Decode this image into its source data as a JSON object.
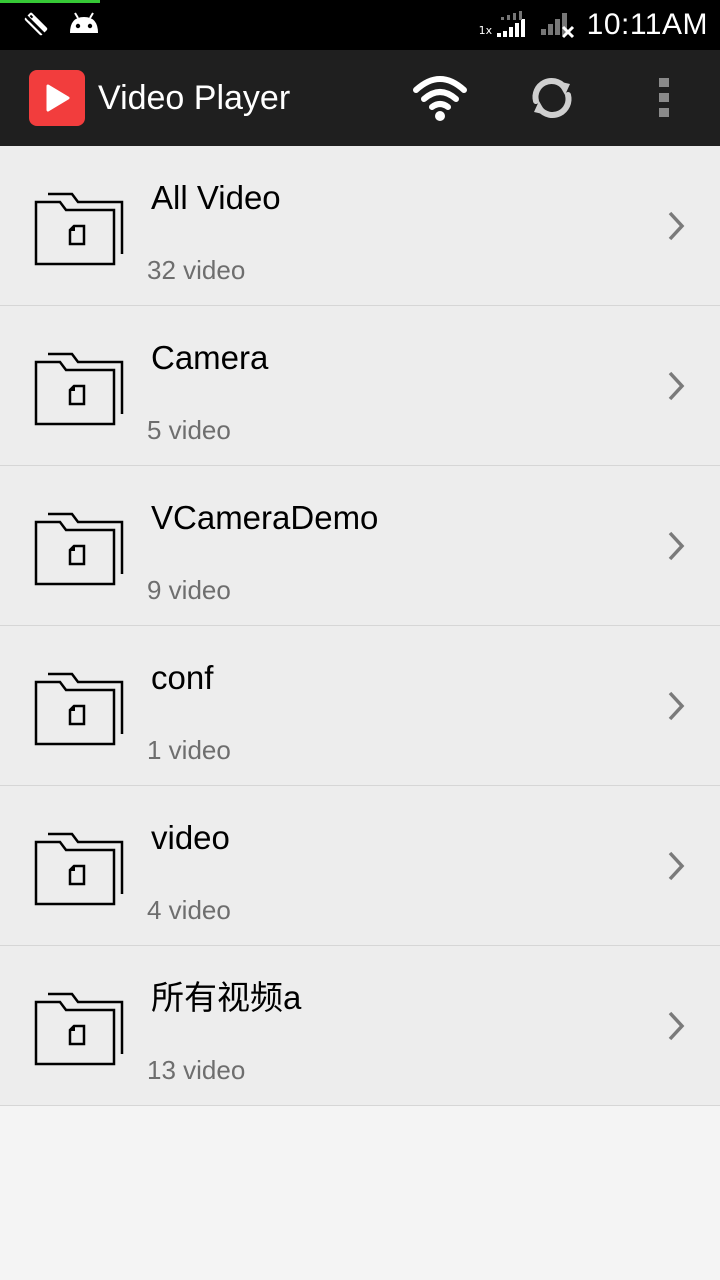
{
  "status_bar": {
    "time": "10:11AM",
    "network_tag": "1x",
    "icons": [
      "usb-debug-icon",
      "android-icon",
      "signal-1x-icon",
      "signal-icon"
    ]
  },
  "app_bar": {
    "title": "Video Player",
    "actions": [
      "wifi-icon",
      "refresh-icon",
      "overflow-menu-icon"
    ],
    "logo_color": "#f23d3d"
  },
  "folders": [
    {
      "name": "All Video",
      "count": "32 video"
    },
    {
      "name": "Camera",
      "count": "5 video"
    },
    {
      "name": "VCameraDemo",
      "count": "9 video"
    },
    {
      "name": "conf",
      "count": "1 video"
    },
    {
      "name": "video",
      "count": "4 video"
    },
    {
      "name": "所有视频a",
      "count": "13 video"
    }
  ],
  "colors": {
    "status_bar_bg": "#000000",
    "app_bar_bg": "#1f1f1f",
    "list_bg": "#ededed",
    "page_bg": "#f4f4f4",
    "divider": "#d6d6d6",
    "subtext": "#6e6e6e"
  }
}
